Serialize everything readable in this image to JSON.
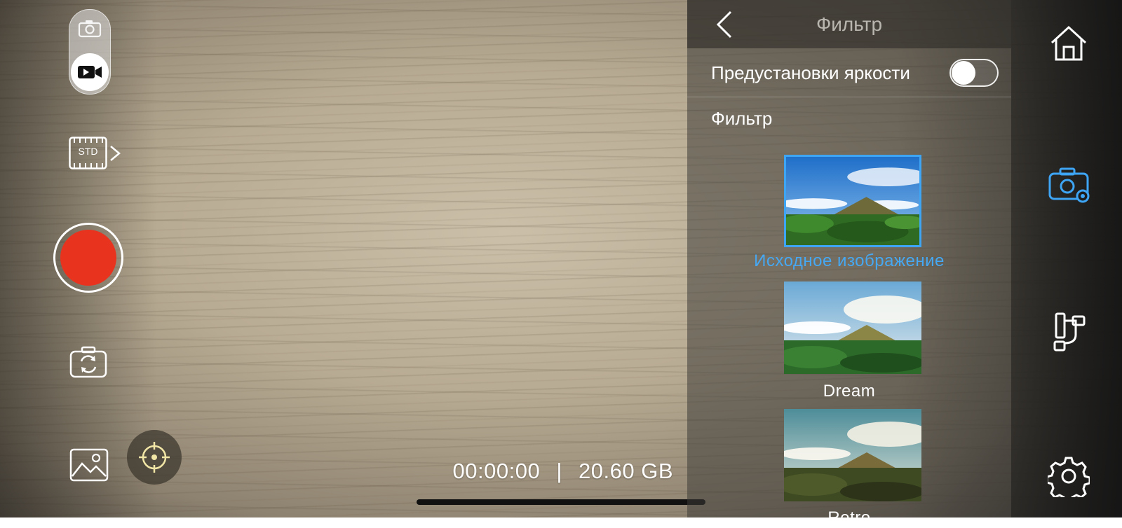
{
  "left_controls": {
    "mode_photo_icon": "camera-icon",
    "mode_video_icon": "video-camera-icon",
    "std_label": "STD",
    "record_color": "#e8341f"
  },
  "status": {
    "timer": "00:00:00",
    "separator": "|",
    "storage": "20.60 GB"
  },
  "panel": {
    "title": "Фильтр",
    "brightness_label": "Предустановки яркости",
    "brightness_toggle_on": false,
    "filter_section_label": "Фильтр",
    "filters": [
      {
        "label": "Исходное изображение",
        "selected": true
      },
      {
        "label": "Dream",
        "selected": false
      },
      {
        "label": "Retro",
        "selected": false
      }
    ],
    "accent_color": "#3ea4f4"
  },
  "sidebar": {
    "icons": [
      "home-icon",
      "camera-settings-icon",
      "gimbal-icon",
      "gear-icon"
    ],
    "active": "camera-settings-icon"
  }
}
